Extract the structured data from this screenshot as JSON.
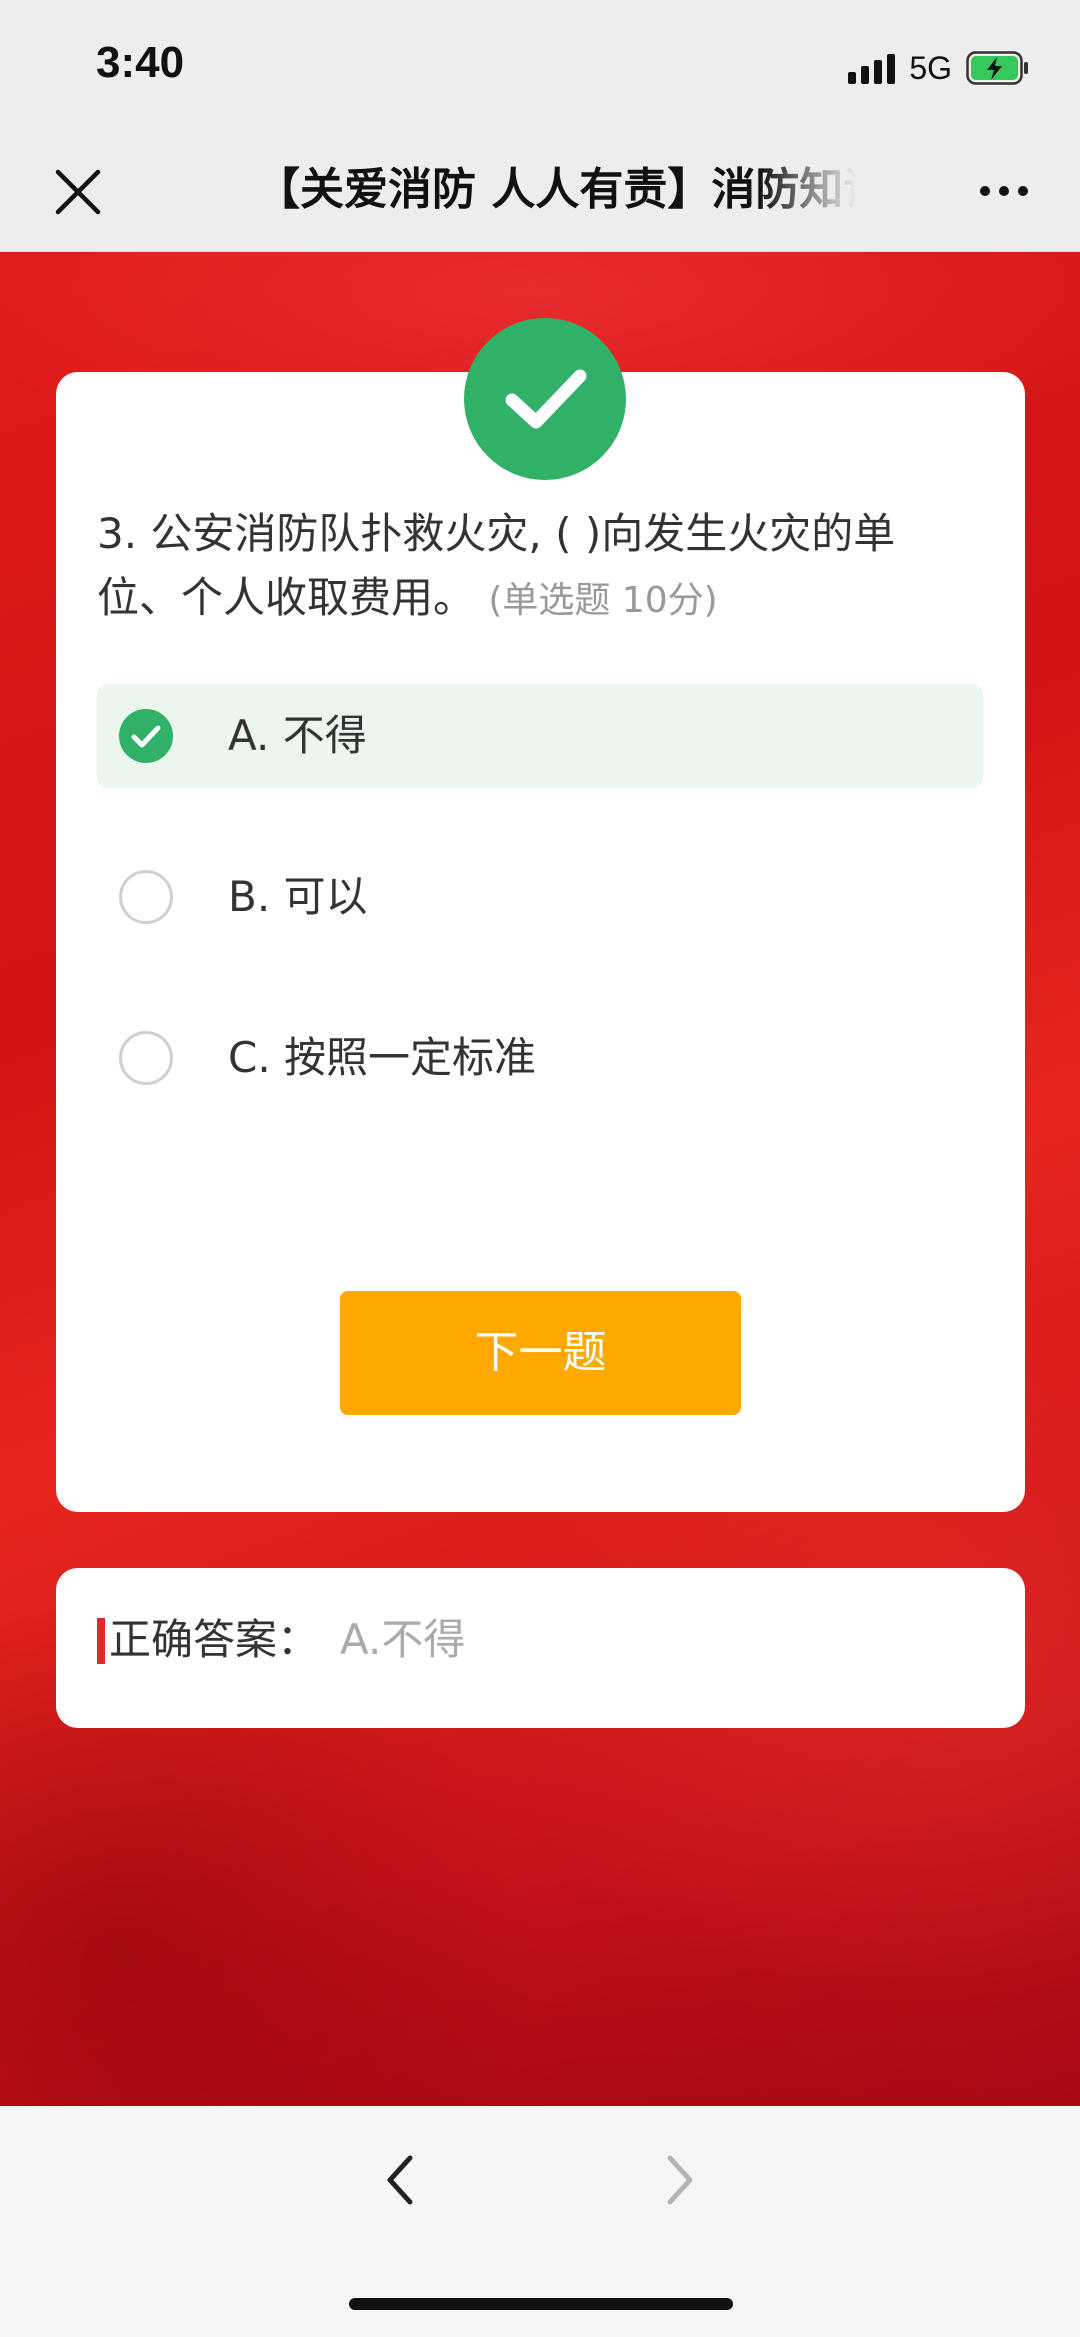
{
  "status_bar": {
    "time": "3:40",
    "network": "5G",
    "icons": [
      "signal-icon",
      "battery-charging-icon"
    ]
  },
  "nav": {
    "title": "【关爱消防 人人有责】消防知识竞赛",
    "close_icon": "close-icon",
    "more_icon": "more-icon"
  },
  "quiz": {
    "result_icon": "check-icon",
    "result_color": "#31b067",
    "question_text": "3. 公安消防队扑救火灾, ( )向发生火灾的单位、个人收取费用。",
    "question_meta": "(单选题 10分)",
    "options": [
      {
        "label": "A. 不得",
        "selected": true
      },
      {
        "label": "B. 可以",
        "selected": false
      },
      {
        "label": "C. 按照一定标准",
        "selected": false
      }
    ],
    "next_button": "下一题",
    "next_button_color": "#ffa800"
  },
  "answer": {
    "label": "正确答案：",
    "value": "A.不得",
    "accent_color": "#e02a2a"
  },
  "toolbar": {
    "back_icon": "chevron-left-icon",
    "forward_icon": "chevron-right-icon"
  }
}
